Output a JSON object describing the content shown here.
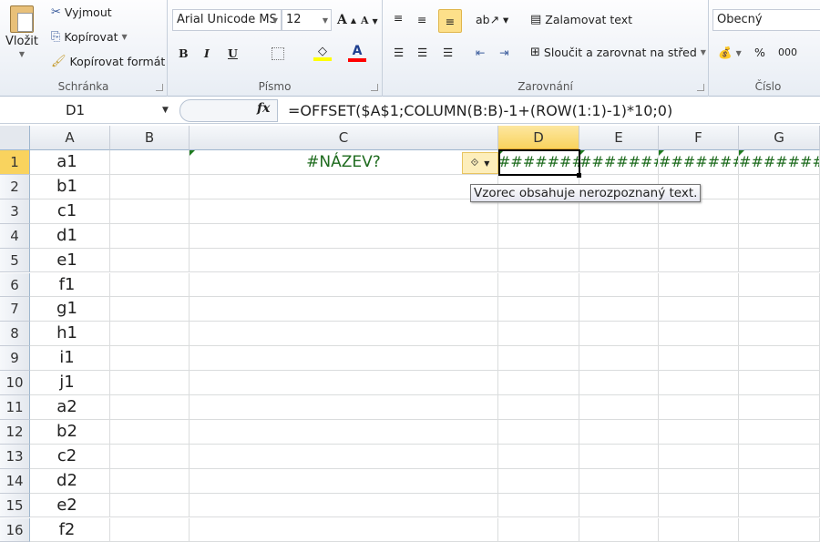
{
  "ribbon": {
    "clipboard": {
      "paste": "Vložit",
      "cut": "Vyjmout",
      "copy": "Kopírovat",
      "format_painter": "Kopírovat formát",
      "label": "Schránka"
    },
    "font": {
      "name": "Arial Unicode MS",
      "size": "12",
      "label": "Písmo",
      "bold": "B",
      "italic": "I",
      "underline": "U",
      "font_color": "A",
      "highlight_color": "#ffff00",
      "font_color_value": "#ff0000"
    },
    "alignment": {
      "wrap": "Zalamovat text",
      "merge": "Sloučit a zarovnat na střed",
      "label": "Zarovnání"
    },
    "number": {
      "format": "Obecný",
      "percent": "%",
      "thousands": "000",
      "label": "Číslo"
    }
  },
  "formula_bar": {
    "name_box": "D1",
    "fx": "fx",
    "formula": "=OFFSET($A$1;COLUMN(B:B)-1+(ROW(1:1)-1)*10;0)"
  },
  "columns": [
    "A",
    "B",
    "C",
    "D",
    "E",
    "F",
    "G"
  ],
  "rows": [
    "1",
    "2",
    "3",
    "4",
    "5",
    "6",
    "7",
    "8",
    "9",
    "10",
    "11",
    "12",
    "13",
    "14",
    "15",
    "16"
  ],
  "col_a": [
    "a1",
    "b1",
    "c1",
    "d1",
    "e1",
    "f1",
    "g1",
    "h1",
    "i1",
    "j1",
    "a2",
    "b2",
    "c2",
    "d2",
    "e2",
    "f2"
  ],
  "row1": {
    "C": "#NÁZEV?",
    "D": "#######",
    "E": "#######",
    "F": "#######",
    "G": "#######"
  },
  "tooltip": "Vzorec obsahuje nerozpoznaný text.",
  "error_color": "#1e6b1e"
}
